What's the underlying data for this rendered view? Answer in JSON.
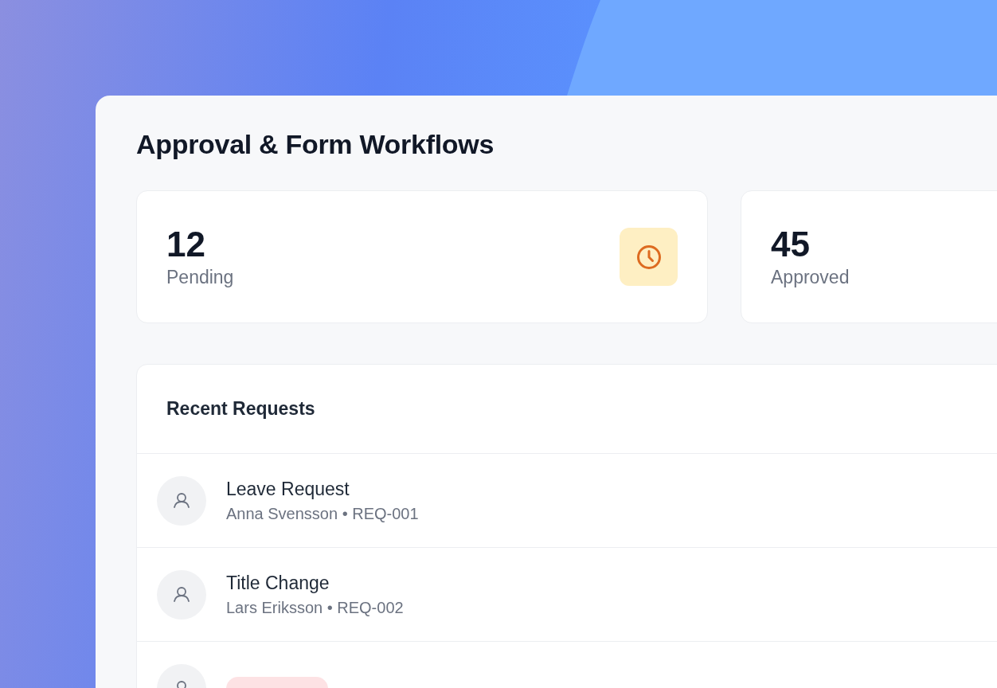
{
  "title": "Approval & Form Workflows",
  "stats": [
    {
      "value": "12",
      "label": "Pending",
      "kind": "pending"
    },
    {
      "value": "45",
      "label": "Approved",
      "kind": "approved"
    }
  ],
  "requests": {
    "title": "Recent Requests",
    "items": [
      {
        "title": "Leave Request",
        "meta": "Anna Svensson • REQ-001"
      },
      {
        "title": "Title Change",
        "meta": "Lars Eriksson • REQ-002"
      },
      {
        "color": "#fde2e4"
      }
    ]
  }
}
